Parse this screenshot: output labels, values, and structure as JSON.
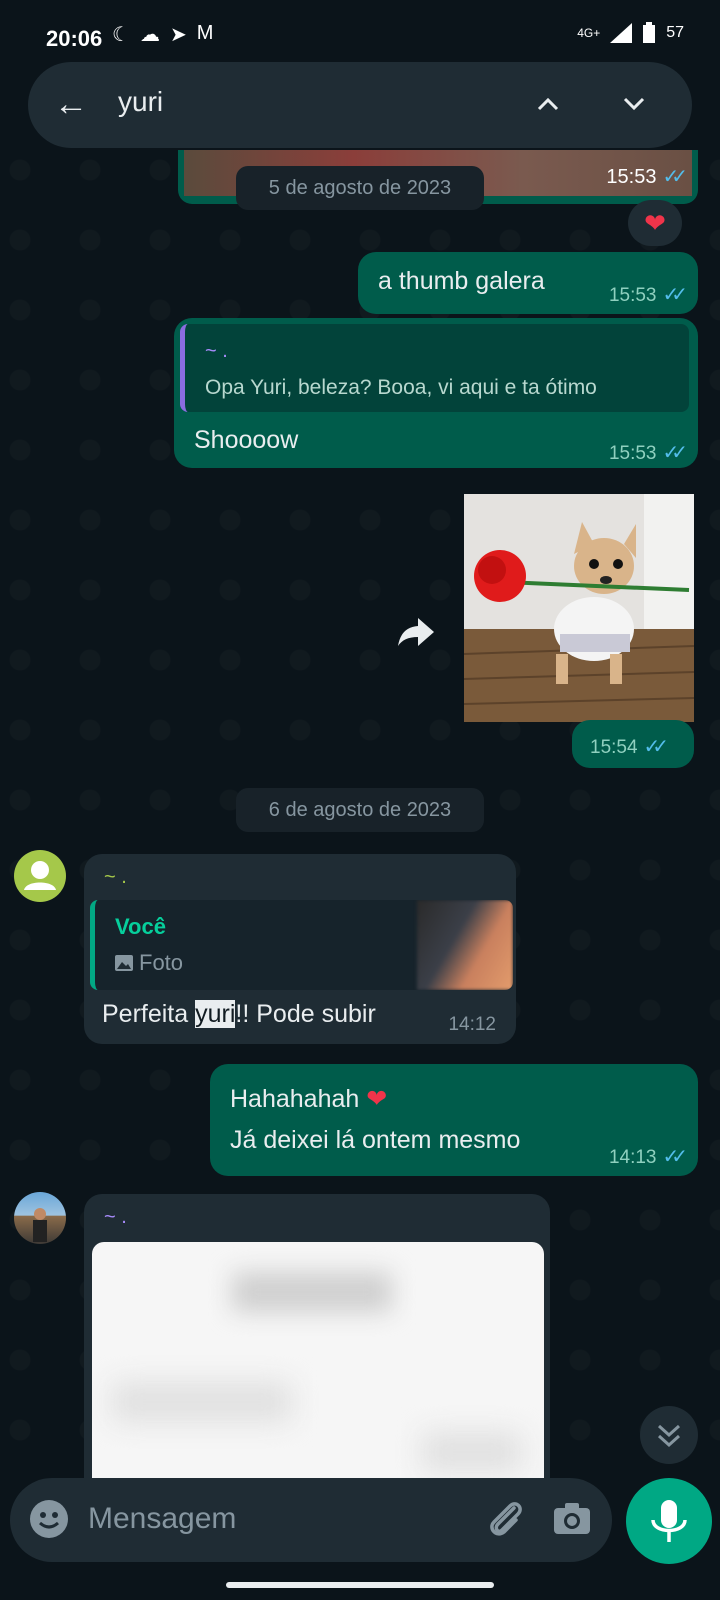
{
  "status": {
    "time": "20:06",
    "left_icons": [
      "moon-icon",
      "cloud-icon",
      "telegram-icon",
      "gmail-icon"
    ],
    "network": "4G+",
    "battery": "57"
  },
  "search": {
    "query": "yuri"
  },
  "messages": {
    "top_time": "15:53",
    "date1": "5 de agosto de 2023",
    "msg1_text": "a thumb galera",
    "msg1_time": "15:53",
    "msg2_quote_author": "~ .",
    "msg2_quote_text": "Opa Yuri, beleza? Booa, vi aqui e ta ótimo",
    "msg2_text": "Shoooow",
    "msg2_time": "15:53",
    "img_time": "15:54",
    "date2": "6 de agosto de 2023",
    "in1_sender": "~ .",
    "in1_quote_author": "Você",
    "in1_quote_text": "Foto",
    "in1_text_before": "Perfeita ",
    "in1_text_highlight": "yuri",
    "in1_text_after": "!! Pode subir",
    "in1_time": "14:12",
    "out3_line1": "Hahahahah",
    "out3_line2": "Já deixei lá ontem mesmo",
    "out3_time": "14:13",
    "in2_sender": "~ ."
  },
  "composer": {
    "placeholder": "Mensagem"
  },
  "colors": {
    "accent": "#00a884",
    "outgoing": "#005c4b",
    "incoming": "#1f2c34",
    "background": "#0b141a"
  }
}
